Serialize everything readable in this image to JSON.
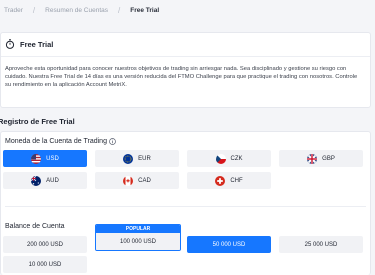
{
  "breadcrumb": {
    "items": [
      "Trader",
      "Resumen de Cuentas",
      "Free Trial"
    ]
  },
  "trial": {
    "title": "Free Trial",
    "description": "Aproveche esta oportunidad para conocer nuestros objetivos de trading sin arriesgar nada. Sea disciplinado y gestione su riesgo con cuidado. Nuestra Free Trial de 14 días es una versión reducida del FTMO Challenge para que practique el trading con nosotros. Controle su rendimiento en la aplicación Account MetriX."
  },
  "registration": {
    "title": "Registro de Free Trial",
    "currency_label": "Moneda de la Cuenta de Trading",
    "currencies": [
      {
        "code": "USD",
        "flag": "us-flag-icon",
        "selected": true
      },
      {
        "code": "EUR",
        "flag": "eu-flag-icon",
        "selected": false
      },
      {
        "code": "CZK",
        "flag": "cz-flag-icon",
        "selected": false
      },
      {
        "code": "GBP",
        "flag": "gb-flag-icon",
        "selected": false
      },
      {
        "code": "AUD",
        "flag": "au-flag-icon",
        "selected": false
      },
      {
        "code": "CAD",
        "flag": "ca-flag-icon",
        "selected": false
      },
      {
        "code": "CHF",
        "flag": "ch-flag-icon",
        "selected": false
      }
    ],
    "balance_label": "Balance de Cuenta",
    "popular_tag": "POPULAR",
    "balances": [
      {
        "label": "200 000 USD",
        "selected": false
      },
      {
        "label": "100 000 USD",
        "selected": false,
        "popular": true
      },
      {
        "label": "50 000 USD",
        "selected": true
      },
      {
        "label": "25 000 USD",
        "selected": false
      },
      {
        "label": "10 000 USD",
        "selected": false
      }
    ]
  },
  "colors": {
    "accent": "#1677ff",
    "option_bg": "#f1f2f5",
    "page_bg": "#f4f5f8"
  }
}
